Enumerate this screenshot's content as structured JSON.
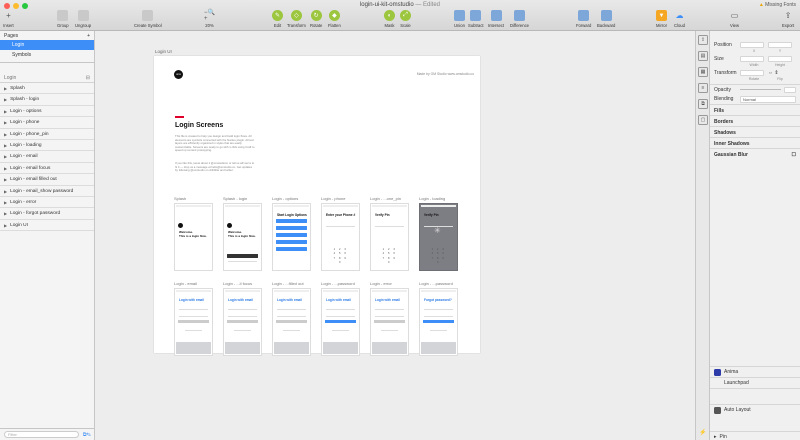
{
  "window": {
    "title": "login-ui-kit-omstudio",
    "edited": "— Edited",
    "missing_fonts": "Missing Fonts"
  },
  "toolbar": {
    "insert": "Insert",
    "group": "Group",
    "ungroup": "Ungroup",
    "create_symbol": "Create Symbol",
    "zoom": "20%",
    "edit": "Edit",
    "transform": "Transform",
    "rotate": "Rotate",
    "flatten": "Flatten",
    "mask": "Mask",
    "scale": "Scale",
    "union": "Union",
    "subtract": "Subtract",
    "intersect": "Intersect",
    "difference": "Difference",
    "forward": "Forward",
    "backward": "Backward",
    "mirror": "Mirror",
    "cloud": "Cloud",
    "view": "View",
    "export": "Export"
  },
  "pages": {
    "header": "Pages",
    "items": [
      "Login",
      "Symbols"
    ]
  },
  "layers": {
    "header": "Login",
    "items": [
      "Splash",
      "Splash - login",
      "Login - options",
      "Login - phone",
      "Login - phone_pin",
      "Login - loading",
      "Login - email",
      "Login - email focus",
      "Login - email filled out",
      "Login - email_show password",
      "Login - error",
      "Login - forgot password",
      "Login UI"
    ],
    "filter_placeholder": "Filter"
  },
  "canvas": {
    "artboard_label": "Login UI",
    "logo_text": "oms",
    "made_by": "Made by OM Studio www.omstudio.co",
    "title": "Login Screens",
    "body1": "This file is created to help you design and build login flows. All elements are symbols connected with the Nucleo plugin. All text layers are efficiently organized in styles that are easily customizable. Screens are ready to go with 1 click using Craft to speed up content prototyping.",
    "body2": "If you like this, tweet about it @omstudioco or tell us all! we're to hi it — drop us a message at hello@omstudio.co. Get updates by following @omstudio on dribbble and twitter.",
    "row1": [
      {
        "label": "Splash",
        "heading": "Welcome.",
        "sub": "This is a login flow."
      },
      {
        "label": "Splash - login",
        "heading": "Welcome.",
        "sub": "This is a login flow."
      },
      {
        "label": "Login - options",
        "heading": "Start Login Options"
      },
      {
        "label": "Login - phone",
        "heading": "Enter your Phone #"
      },
      {
        "label": "Login - ...one_pin",
        "heading": "Verify Pin"
      },
      {
        "label": "Login - loading",
        "heading": "Verify Pin"
      }
    ],
    "row2": [
      {
        "label": "Login - email",
        "heading": "Login with email"
      },
      {
        "label": "Login - ...il focus",
        "heading": "Login with email"
      },
      {
        "label": "Login - ...filled out",
        "heading": "Login with email"
      },
      {
        "label": "Login - ...password",
        "heading": "Login with email"
      },
      {
        "label": "Login - error",
        "heading": "Login with email"
      },
      {
        "label": "Login - ...password",
        "heading": "Forgot password?"
      }
    ],
    "keyboard": "q w e r t y u i o p\na s d f g h j k l\nz x c v b n m"
  },
  "inspector": {
    "position": "Position",
    "size": "Size",
    "transform": "Transform",
    "x": "X",
    "y": "Y",
    "width": "Width",
    "height": "Height",
    "rotate": "Rotate",
    "flip": "Flip",
    "opacity": "Opacity",
    "blending": "Blending",
    "blending_value": "Normal",
    "fills": "Fills",
    "borders": "Borders",
    "shadows": "Shadows",
    "inner_shadows": "Inner Shadows",
    "gaussian_blur": "Gaussian Blur",
    "plugins": [
      "Anima",
      "Launchpad",
      "Auto Layout",
      "Pin"
    ]
  }
}
